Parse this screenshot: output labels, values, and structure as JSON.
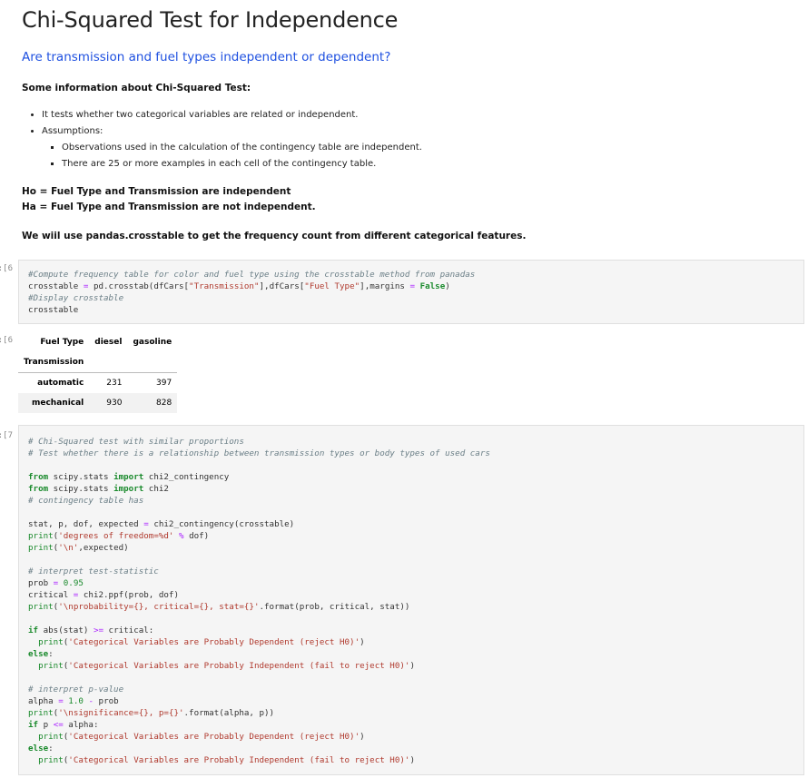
{
  "title": "Chi-Squared Test for Independence",
  "subtitle": "Are transmission and fuel types independent or dependent?",
  "info_heading": "Some information about Chi-Squared Test:",
  "bullets": {
    "b1": "It tests whether two categorical variables are related or independent.",
    "b2": "Assumptions:",
    "s1": "Observations used in the calculation of the contingency table are independent.",
    "s2": "There are 25 or more examples in each cell of the contingency table."
  },
  "ho": "Ho = Fuel Type and Transmission are independent",
  "ha": "Ha = Fuel Type and Transmission are not independent.",
  "crosstab_note": "We wiil use pandas.crosstable to get the frequency count from different categorical features.",
  "prompts": {
    "p1": "6]:",
    "p2": "6]:",
    "p3": "7]:"
  },
  "cell1": {
    "line1": "#Compute frequency table for color and fuel type using the crosstable method from panadas",
    "l2a": "crosstable ",
    "l2b": "=",
    "l2c": " pd.crosstab(dfCars[",
    "l2d": "\"Transmission\"",
    "l2e": "],dfCars[",
    "l2f": "\"Fuel Type\"",
    "l2g": "],margins ",
    "l2h": "=",
    "l2i": " ",
    "l2j": "False",
    "l2k": ")",
    "line3": "#Display crosstable",
    "line4": "crosstable"
  },
  "table": {
    "col_header": "Fuel Type",
    "columns": [
      "diesel",
      "gasoline"
    ],
    "index_name": "Transmission",
    "rows": [
      {
        "label": "automatic",
        "values": [
          "231",
          "397"
        ]
      },
      {
        "label": "mechanical",
        "values": [
          "930",
          "828"
        ]
      }
    ]
  },
  "cell2": {
    "c1": "# Chi-Squared test with similar proportions",
    "c2": "# Test whether there is a relationship between transmission types or body types of used cars",
    "from": "from",
    "import": "import",
    "i1mod": " scipy.stats ",
    "i1name": " chi2_contingency",
    "i2name": " chi2",
    "c3": "# contingency table has",
    "s1a": "stat, p, dof, expected ",
    "eq": "=",
    "s1b": " chi2_contingency(crosstable)",
    "print": "print",
    "p1a": "(",
    "p1str": "'degrees of freedom=%d'",
    "p1op": " % ",
    "p1b": "dof)",
    "p2str": "'\\n'",
    "p2b": ",expected)",
    "c4": "# interpret test-statistic",
    "prob_a": "prob ",
    "prob_v": "0.95",
    "crit_a": "critical ",
    "crit_b": " chi2.ppf(prob, dof)",
    "p3str": "'\\nprobability={}, critical={}, stat={}'",
    "p3b": ".format(prob, critical, stat))",
    "if": "if",
    "if1a": " abs(stat) ",
    "ge": ">=",
    "if1b": " critical:",
    "dep_str": "'Categorical Variables are Probably Dependent (reject H0)'",
    "else": "else",
    "colon": ":",
    "ind_str": "'Categorical Variables are Probably Independent (fail to reject H0)'",
    "c5": "# interpret p-value",
    "alpha_a": "alpha ",
    "alpha_v": "1.0",
    "minus": "-",
    "alpha_b": " prob",
    "p4str": "'\\nsignificance={}, p={}'",
    "p4b": ".format(alpha, p))",
    "if2a": " p ",
    "le": "<=",
    "if2b": " alpha:",
    "close": ")"
  }
}
